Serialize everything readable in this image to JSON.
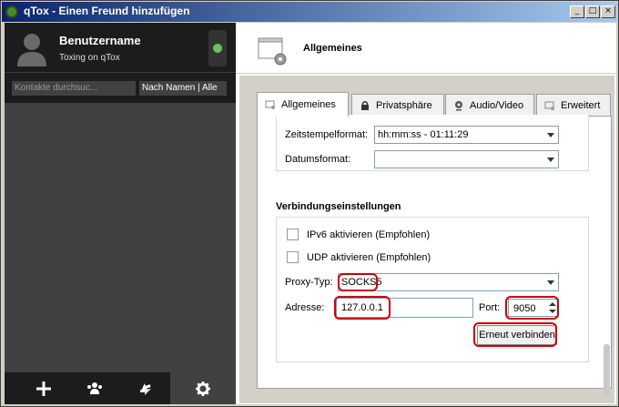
{
  "window": {
    "title": "qTox - Einen Freund hinzufügen",
    "controls": [
      "_",
      "□",
      "×"
    ]
  },
  "profile": {
    "name": "Benutzername",
    "status_message": "Toxing on qTox",
    "status_color": "#6bc260"
  },
  "contacts": {
    "search_placeholder": "Kontakte durchsuc...",
    "sort_label": "Nach Namen | Alle"
  },
  "bottom_bar": {
    "icons": [
      "add-friend-icon",
      "group-icon",
      "transfer-icon",
      "settings-icon"
    ]
  },
  "settings": {
    "header_title": "Allgemeines",
    "tabs": [
      {
        "label": "Allgemeines",
        "icon": "general-icon",
        "active": true
      },
      {
        "label": "Privatsphäre",
        "icon": "lock-icon",
        "active": false
      },
      {
        "label": "Audio/Video",
        "icon": "webcam-icon",
        "active": false
      },
      {
        "label": "Erweitert",
        "icon": "advanced-icon",
        "active": false
      }
    ],
    "time_format_label": "Zeitstempelformat:",
    "time_format_value": "hh:mm:ss - 01:11:29",
    "date_format_label": "Datumsformat:",
    "date_format_value": "",
    "connection_heading": "Verbindungseinstellungen",
    "ipv6_label": "IPv6 aktivieren (Empfohlen)",
    "udp_label": "UDP aktivieren (Empfohlen)",
    "proxy_type_label": "Proxy-Typ:",
    "proxy_type_value": "SOCKS5",
    "address_label": "Adresse:",
    "address_value": "127.0.0.1",
    "port_label": "Port:",
    "port_value": "9050",
    "reconnect_label": "Erneut verbinden"
  }
}
